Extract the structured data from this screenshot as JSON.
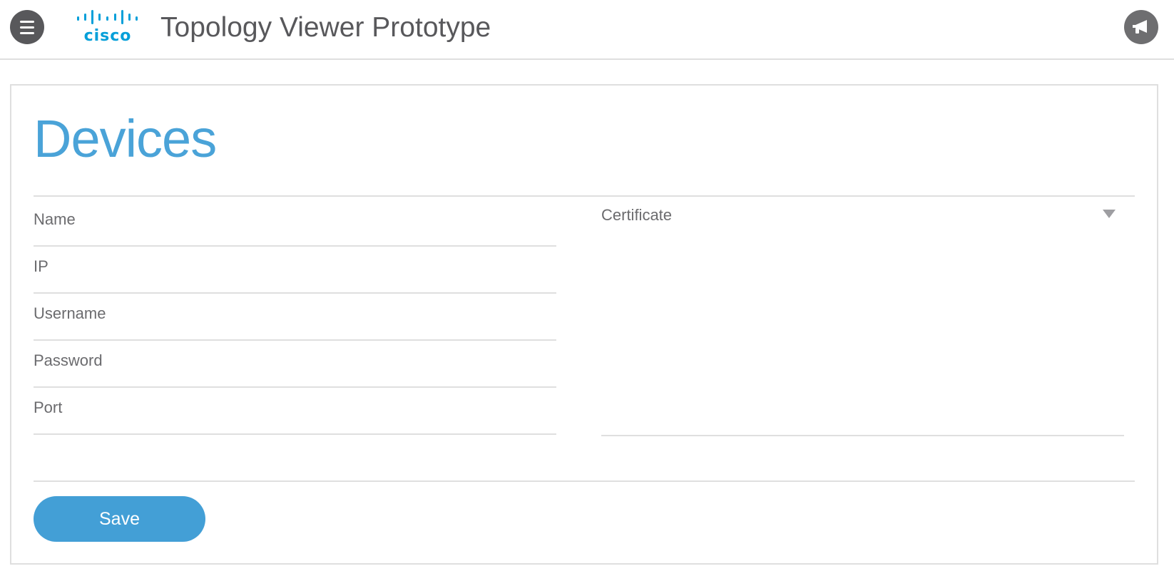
{
  "header": {
    "logo_text": "cisco",
    "app_title": "Topology Viewer Prototype",
    "menu_icon": "hamburger-menu-icon",
    "notify_icon": "megaphone-icon"
  },
  "page": {
    "title": "Devices"
  },
  "form": {
    "name_placeholder": "Name",
    "ip_placeholder": "IP",
    "username_placeholder": "Username",
    "password_placeholder": "Password",
    "port_placeholder": "Port",
    "certificate_label": "Certificate",
    "save_label": "Save"
  },
  "colors": {
    "accent": "#439fd6",
    "brand": "#049fd9",
    "text": "#58585b",
    "border": "#dfdfdf"
  }
}
